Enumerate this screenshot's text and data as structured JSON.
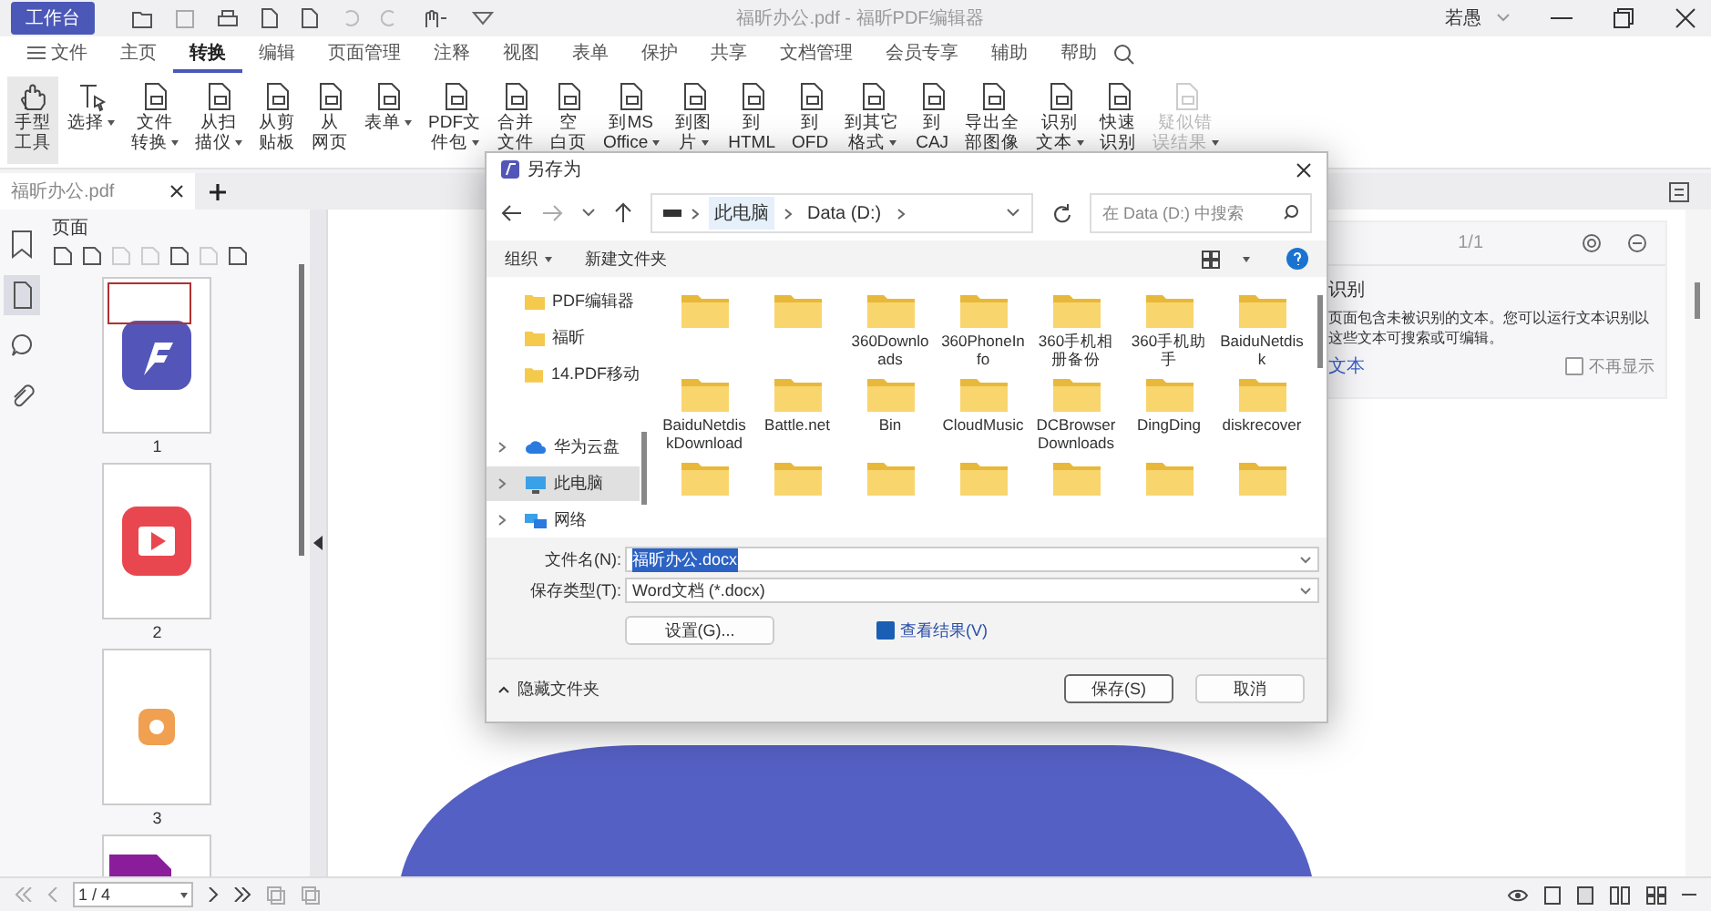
{
  "titlebar": {
    "workbench_button": "工作台",
    "title": "福昕办公.pdf - 福昕PDF编辑器",
    "user": "若愚"
  },
  "menu": [
    {
      "label": "文件",
      "kind": "file",
      "selected": false
    },
    {
      "label": "主页",
      "kind": "tab",
      "selected": false
    },
    {
      "label": "转换",
      "kind": "tab",
      "selected": true
    },
    {
      "label": "编辑",
      "kind": "tab",
      "selected": false
    },
    {
      "label": "页面管理",
      "kind": "tab",
      "selected": false
    },
    {
      "label": "注释",
      "kind": "tab",
      "selected": false
    },
    {
      "label": "视图",
      "kind": "tab",
      "selected": false
    },
    {
      "label": "表单",
      "kind": "tab",
      "selected": false
    },
    {
      "label": "保护",
      "kind": "tab",
      "selected": false
    },
    {
      "label": "共享",
      "kind": "tab",
      "selected": false
    },
    {
      "label": "文档管理",
      "kind": "tab",
      "selected": false
    },
    {
      "label": "会员专享",
      "kind": "tab",
      "selected": false
    },
    {
      "label": "辅助",
      "kind": "tab",
      "selected": false
    },
    {
      "label": "帮助",
      "kind": "tab",
      "selected": false
    }
  ],
  "ribbon": [
    {
      "lines": [
        "手型",
        "工具"
      ],
      "dropdown": false,
      "selected": true,
      "disabled": false
    },
    {
      "lines": [
        "选择"
      ],
      "dropdown": true,
      "selected": false,
      "disabled": false
    },
    {
      "lines": [
        "文件",
        "转换"
      ],
      "dropdown": true,
      "selected": false,
      "disabled": false
    },
    {
      "lines": [
        "从扫",
        "描仪"
      ],
      "dropdown": true,
      "selected": false,
      "disabled": false
    },
    {
      "lines": [
        "从剪",
        "贴板"
      ],
      "dropdown": false,
      "selected": false,
      "disabled": false
    },
    {
      "lines": [
        "从",
        "网页"
      ],
      "dropdown": false,
      "selected": false,
      "disabled": false
    },
    {
      "lines": [
        "表单"
      ],
      "dropdown": true,
      "selected": false,
      "disabled": false
    },
    {
      "lines": [
        "PDF文",
        "件包"
      ],
      "dropdown": true,
      "selected": false,
      "disabled": false
    },
    {
      "lines": [
        "合并",
        "文件"
      ],
      "dropdown": false,
      "selected": false,
      "disabled": false
    },
    {
      "lines": [
        "空",
        "白页"
      ],
      "dropdown": false,
      "selected": false,
      "disabled": false
    },
    {
      "lines": [
        "到MS",
        "Office"
      ],
      "dropdown": true,
      "selected": false,
      "disabled": false
    },
    {
      "lines": [
        "到图",
        "片"
      ],
      "dropdown": true,
      "selected": false,
      "disabled": false
    },
    {
      "lines": [
        "到",
        "HTML"
      ],
      "dropdown": false,
      "selected": false,
      "disabled": false
    },
    {
      "lines": [
        "到",
        "OFD"
      ],
      "dropdown": false,
      "selected": false,
      "disabled": false
    },
    {
      "lines": [
        "到其它",
        "格式"
      ],
      "dropdown": true,
      "selected": false,
      "disabled": false
    },
    {
      "lines": [
        "到",
        "CAJ"
      ],
      "dropdown": false,
      "selected": false,
      "disabled": false
    },
    {
      "lines": [
        "导出全",
        "部图像"
      ],
      "dropdown": false,
      "selected": false,
      "disabled": false
    },
    {
      "lines": [
        "识别",
        "文本"
      ],
      "dropdown": true,
      "selected": false,
      "disabled": false
    },
    {
      "lines": [
        "快速",
        "识别"
      ],
      "dropdown": false,
      "selected": false,
      "disabled": false
    },
    {
      "lines": [
        "疑似错",
        "误结果"
      ],
      "dropdown": true,
      "selected": false,
      "disabled": true
    }
  ],
  "document_tab": {
    "label": "福昕办公.pdf"
  },
  "side_tabs": [
    {
      "selected": false
    },
    {
      "selected": true
    },
    {
      "selected": false
    },
    {
      "selected": false
    }
  ],
  "pages_panel": {
    "title": "页面",
    "thumbnails": [
      {
        "number": "1",
        "selected": true
      },
      {
        "number": "2",
        "selected": false
      },
      {
        "number": "3",
        "selected": false
      },
      {
        "selected": false
      }
    ]
  },
  "ocr_panel": {
    "page_indicator": "1/1",
    "title": "识别",
    "message": [
      "页面包含未被识别的文本。您可以运行文本识别以",
      "这些文本可搜索或可编辑。"
    ],
    "link": "文本",
    "dont_show": {
      "label": "不再显示",
      "checked": false
    }
  },
  "dialog": {
    "title": "另存为",
    "breadcrumb": [
      "此电脑",
      "Data (D:)"
    ],
    "search_placeholder": "在 Data (D:) 中搜索",
    "organize": "组织",
    "new_folder": "新建文件夹",
    "nav": [
      {
        "label": "PDF编辑器",
        "kind": "folder",
        "selected": false
      },
      {
        "label": "福昕",
        "kind": "folder",
        "selected": false
      },
      {
        "label": "14.PDF移动",
        "kind": "folder",
        "selected": false
      },
      {
        "label": "华为云盘",
        "kind": "cloud",
        "selected": false
      },
      {
        "label": "此电脑",
        "kind": "computer",
        "selected": true
      },
      {
        "label": "网络",
        "kind": "network",
        "selected": false
      }
    ],
    "folders": [
      {
        "kind": "folder"
      },
      {
        "kind": "folder"
      },
      {
        "kind": "folder",
        "name": "360Downloads"
      },
      {
        "kind": "folder",
        "name": "360PhoneInfo"
      },
      {
        "kind": "folder",
        "name": "360手机相册备份"
      },
      {
        "kind": "folder",
        "name": "360手机助手"
      },
      {
        "kind": "folder",
        "name": "BaiduNetdisk"
      },
      {
        "kind": "folder",
        "name": "BaiduNetdiskDownload"
      },
      {
        "kind": "folder",
        "name": "Battle.net"
      },
      {
        "kind": "folder",
        "name": "Bin"
      },
      {
        "kind": "folder",
        "name": "CloudMusic"
      },
      {
        "kind": "folder",
        "name": "DCBrowserDownloads"
      },
      {
        "kind": "folder",
        "name": "DingDing"
      },
      {
        "kind": "folder",
        "name": "diskrecover"
      },
      {
        "kind": "folder"
      },
      {
        "kind": "folder"
      },
      {
        "kind": "folder"
      },
      {
        "kind": "folder"
      },
      {
        "kind": "folder"
      },
      {
        "kind": "folder"
      },
      {
        "kind": "folder"
      }
    ],
    "filename_label": "文件名(N):",
    "filename": "福昕办公.docx",
    "filetype_label": "保存类型(T):",
    "filetype": "Word文档 (*.docx)",
    "settings_button": "设置(G)...",
    "view_result": {
      "label": "查看结果(V)",
      "checked": true
    },
    "hide_folders": "隐藏文件夹",
    "save_button": "保存(S)",
    "cancel_button": "取消"
  },
  "status_bar": {
    "page_field": "1 / 4"
  }
}
